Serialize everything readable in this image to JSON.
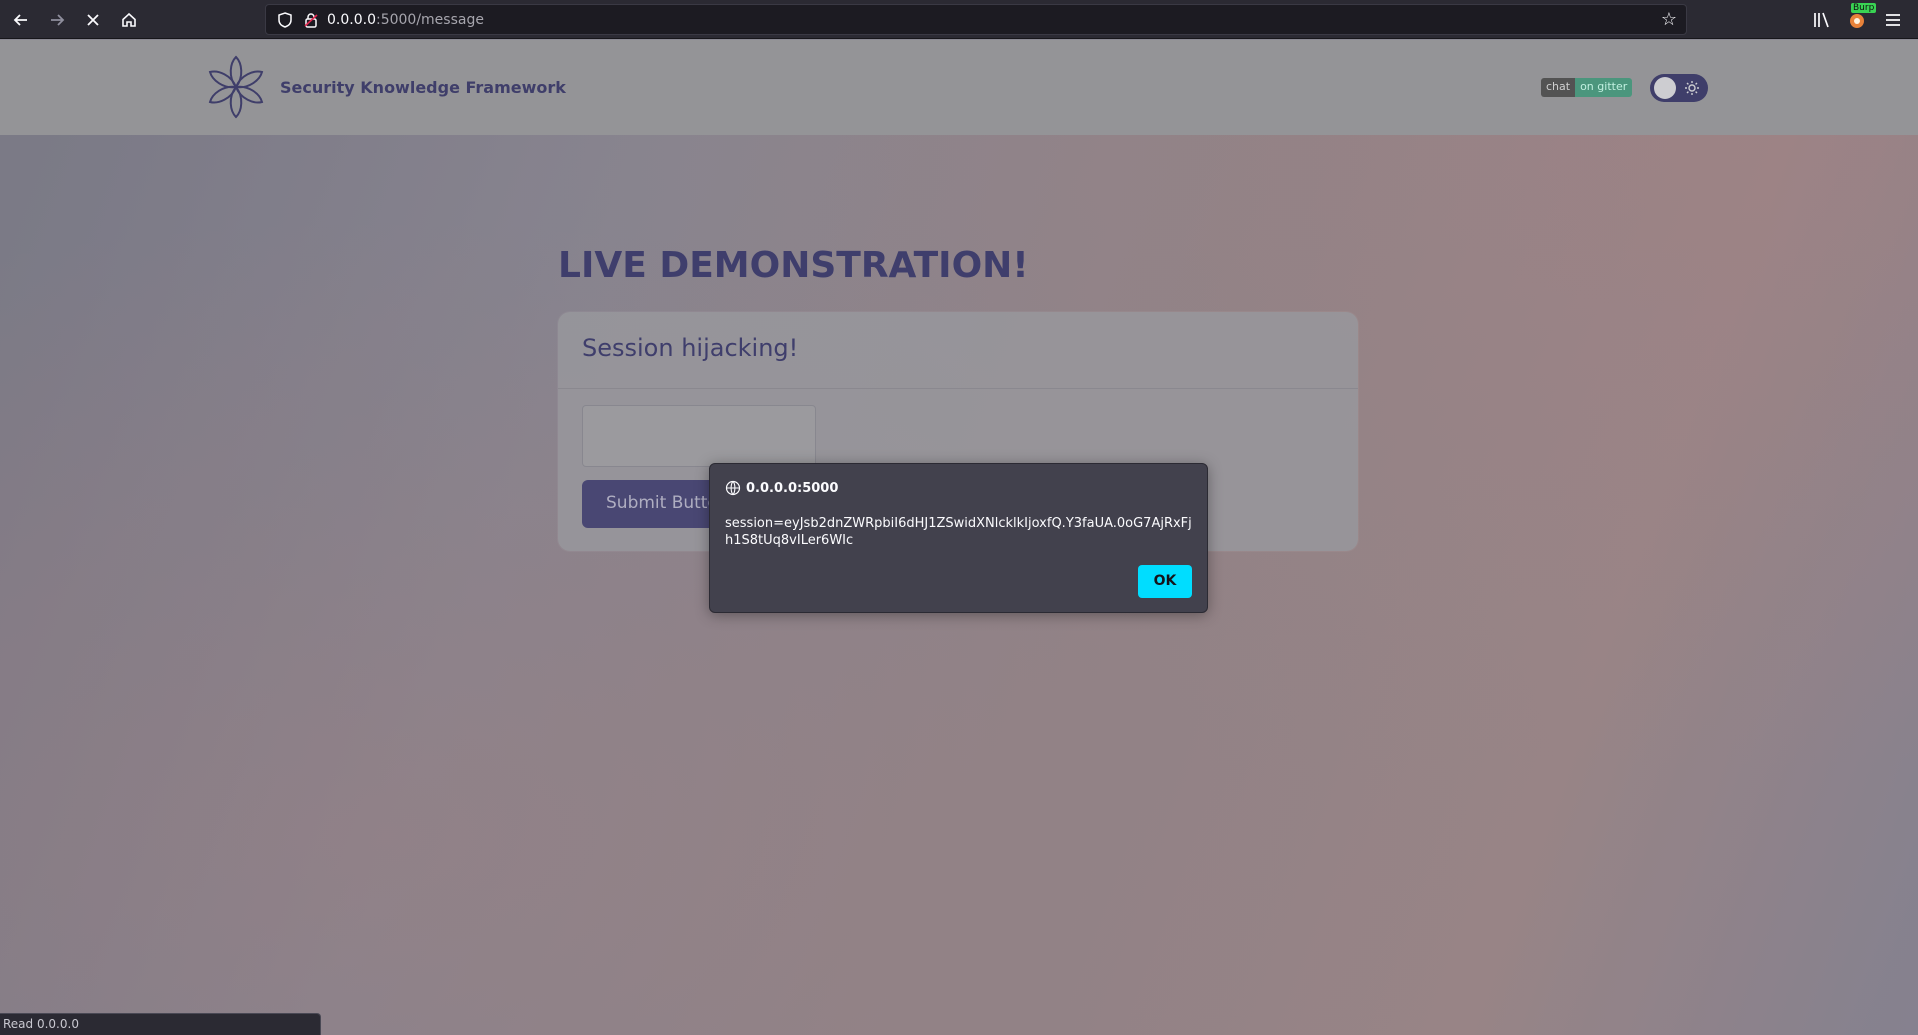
{
  "browser": {
    "url_host": "0.0.0.0",
    "url_path": ":5000/message",
    "extension_badge": "Burp"
  },
  "site": {
    "brand": "Security Knowledge Framework",
    "gitter_left": "chat",
    "gitter_right": "on gitter"
  },
  "main": {
    "title": "LIVE DEMONSTRATION!",
    "card_title": "Session hijacking!",
    "submit_label": "Submit Button"
  },
  "dialog": {
    "origin": "0.0.0.0:5000",
    "message": "session=eyJsb2dnZWRpbiI6dHJ1ZSwidXNlcklkIjoxfQ.Y3faUA.0oG7AjRxFjh1S8tUq8vILer6WIc",
    "ok_label": "OK"
  },
  "status": {
    "text": "Read 0.0.0.0"
  },
  "colors": {
    "accent": "#3f3e70",
    "dialog_button": "#00ddff",
    "gitter_green": "#4c9e83"
  }
}
